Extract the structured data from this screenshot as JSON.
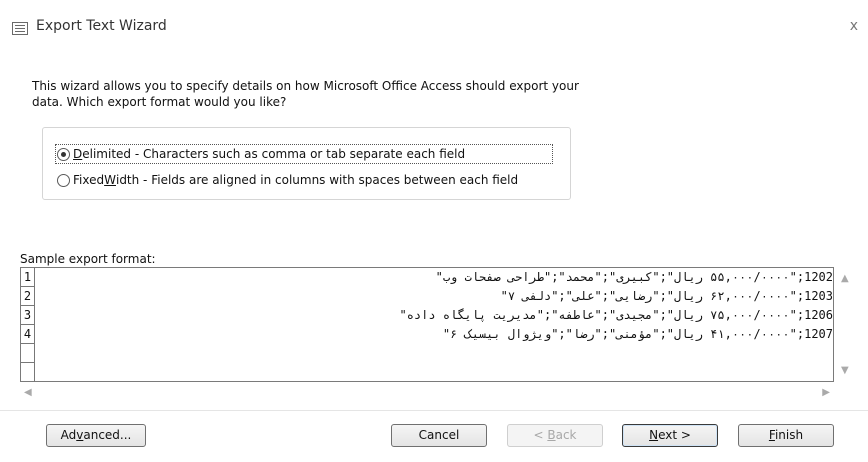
{
  "window": {
    "title": "Export Text Wizard",
    "close_glyph": "x"
  },
  "description": "This wizard allows you to specify details on how Microsoft Office Access should export your data. Which export format would you like?",
  "options": [
    {
      "accel": "D",
      "rest": "elimited - Characters such as comma or tab separate each field",
      "selected": true
    },
    {
      "before": "Fixed ",
      "accel": "W",
      "rest": "idth - Fields are aligned in columns with spaces between each field",
      "selected": false
    }
  ],
  "sample": {
    "label": "Sample export format:",
    "rows": [
      {
        "num": "1",
        "text": "1202;\"۵۵,۰۰۰/۰۰۰۰ ریال\";\"کبیری\";\"محمد\";\"طراحی صفحات وب\""
      },
      {
        "num": "2",
        "text": "1203;\"۶۲,۰۰۰/۰۰۰۰ ریال\";\"رضایی\";\"علی\";\"دلفی ۷\""
      },
      {
        "num": "3",
        "text": "1206;\"۷۵,۰۰۰/۰۰۰۰ ریال\";\"مجیدی\";\"عاطفه\";\"مدیریت پایگاه داده\""
      },
      {
        "num": "4",
        "text": "1207;\"۴۱,۰۰۰/۰۰۰۰ ریال\";\"مؤمنی\";\"رضا\";\"ویژوال بیسیک ۶\""
      }
    ]
  },
  "buttons": {
    "advanced": {
      "before": "Ad",
      "accel": "v",
      "rest": "anced..."
    },
    "cancel": "Cancel",
    "back": {
      "before": "< ",
      "accel": "B",
      "rest": "ack"
    },
    "next": {
      "accel": "N",
      "rest": "ext >"
    },
    "finish": {
      "accel": "F",
      "rest": "inish"
    }
  },
  "colors": {
    "disabled_text": "#a8a8a8",
    "border": "#7a7a7a"
  }
}
